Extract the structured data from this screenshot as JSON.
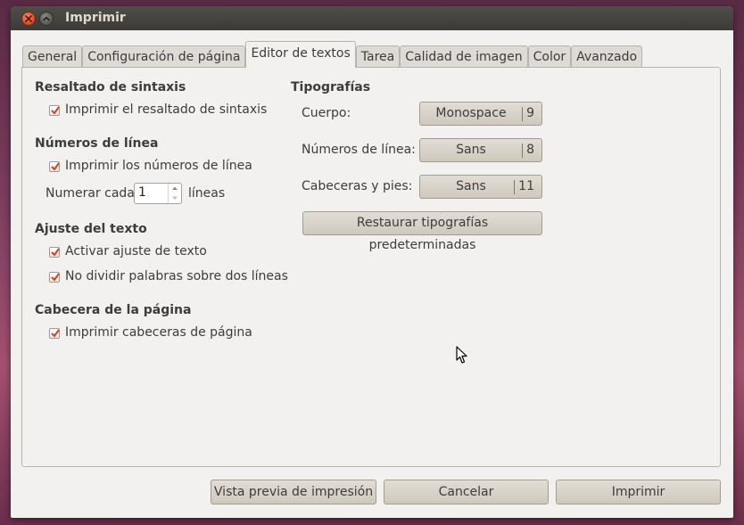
{
  "window": {
    "title": "Imprimir"
  },
  "tabs": [
    {
      "label": "General"
    },
    {
      "label": "Configuración de página"
    },
    {
      "label": "Editor de textos",
      "active": true
    },
    {
      "label": "Tarea"
    },
    {
      "label": "Calidad de imagen"
    },
    {
      "label": "Color"
    },
    {
      "label": "Avanzado"
    }
  ],
  "syntax": {
    "heading": "Resaltado de sintaxis",
    "print_highlight": {
      "label": "Imprimir el resaltado de sintaxis",
      "checked": true
    }
  },
  "line_numbers": {
    "heading": "Números de línea",
    "print_numbers": {
      "label": "Imprimir los números de línea",
      "checked": true
    },
    "number_every_label": "Numerar cada",
    "number_every_value": "1",
    "lines_suffix": "líneas"
  },
  "wrap": {
    "heading": "Ajuste del texto",
    "enable_wrap": {
      "label": "Activar ajuste de texto",
      "checked": true
    },
    "no_split_words": {
      "label": "No dividir palabras sobre dos líneas",
      "checked": true
    }
  },
  "page_header": {
    "heading": "Cabecera de la página",
    "print_headers": {
      "label": "Imprimir cabeceras de página",
      "checked": true
    }
  },
  "fonts": {
    "heading": "Tipografías",
    "body": {
      "label": "Cuerpo:",
      "font": "Monospace",
      "size": "9"
    },
    "line_numbers": {
      "label": "Números de línea:",
      "font": "Sans",
      "size": "8"
    },
    "headers_footers": {
      "label": "Cabeceras y pies:",
      "font": "Sans",
      "size": "11"
    },
    "restore_label": "Restaurar tipografías predeterminadas"
  },
  "actions": {
    "preview_label": "Vista previa de impresión",
    "cancel_label": "Cancelar",
    "print_label": "Imprimir"
  },
  "colors": {
    "accent_check": "#d2411e",
    "titlebar": "#3c3b37",
    "dialog_bg": "#f2f1f0"
  }
}
